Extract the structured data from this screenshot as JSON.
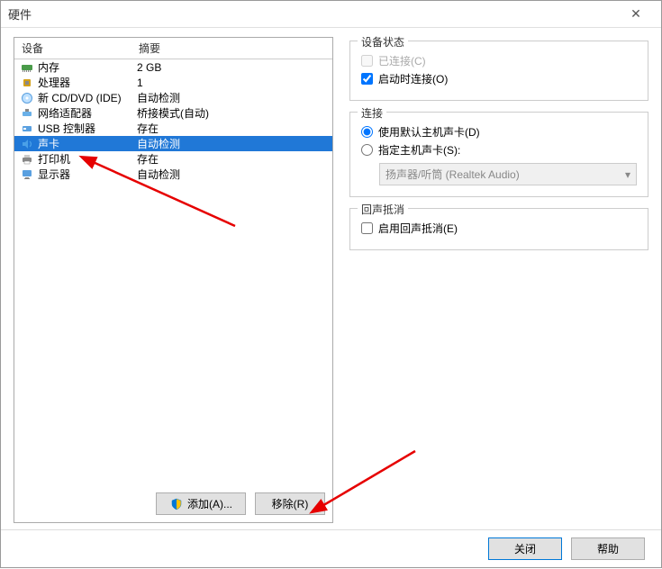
{
  "window": {
    "title": "硬件",
    "close": "✕"
  },
  "columns": {
    "device": "设备",
    "summary": "摘要"
  },
  "devices": [
    {
      "name": "内存",
      "summary": "2 GB",
      "icon": "memory"
    },
    {
      "name": "处理器",
      "summary": "1",
      "icon": "cpu"
    },
    {
      "name": "新 CD/DVD (IDE)",
      "summary": "自动检测",
      "icon": "disc"
    },
    {
      "name": "网络适配器",
      "summary": "桥接模式(自动)",
      "icon": "network"
    },
    {
      "name": "USB 控制器",
      "summary": "存在",
      "icon": "usb"
    },
    {
      "name": "声卡",
      "summary": "自动检测",
      "icon": "sound",
      "selected": true
    },
    {
      "name": "打印机",
      "summary": "存在",
      "icon": "printer"
    },
    {
      "name": "显示器",
      "summary": "自动检测",
      "icon": "display"
    }
  ],
  "buttons": {
    "add": "添加(A)...",
    "remove": "移除(R)",
    "close": "关闭",
    "help": "帮助"
  },
  "groups": {
    "status": {
      "title": "设备状态",
      "connected": "已连接(C)",
      "connect_on_start": "启动时连接(O)"
    },
    "connection": {
      "title": "连接",
      "use_default": "使用默认主机声卡(D)",
      "specify": "指定主机声卡(S):",
      "selected_card": "扬声器/听筒 (Realtek Audio)"
    },
    "echo": {
      "title": "回声抵消",
      "enable": "启用回声抵消(E)"
    }
  }
}
